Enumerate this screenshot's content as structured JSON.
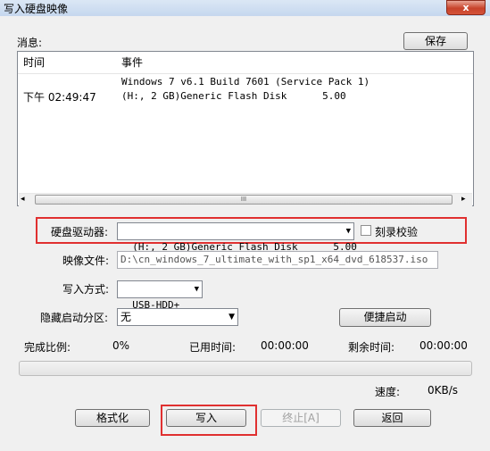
{
  "window": {
    "title": "写入硬盘映像",
    "close_label": "x"
  },
  "messages": {
    "label": "消息:",
    "save_button": "保存",
    "columns": {
      "time": "时间",
      "event": "事件"
    },
    "rows": [
      {
        "time": "",
        "event": "Windows 7 v6.1 Build 7601 (Service Pack 1)"
      },
      {
        "time": "下午 02:49:47",
        "event": "(H:, 2 GB)Generic Flash Disk      5.00"
      }
    ],
    "scroll_thumb": "III"
  },
  "drive": {
    "label": "硬盘驱动器:",
    "value": "(H:, 2 GB)Generic Flash Disk      5.00",
    "verify_label": "刻录校验",
    "verify_checked": false
  },
  "image_file": {
    "label": "映像文件:",
    "value": "D:\\cn_windows_7_ultimate_with_sp1_x64_dvd_618537.iso"
  },
  "write_mode": {
    "label": "写入方式:",
    "value": "USB-HDD+"
  },
  "hidden_partition": {
    "label": "隐藏启动分区:",
    "value": "无",
    "quick_boot_button": "便捷启动"
  },
  "status": {
    "percent_label": "完成比例:",
    "percent_value": "0%",
    "elapsed_label": "已用时间:",
    "elapsed_value": "00:00:00",
    "remaining_label": "剩余时间:",
    "remaining_value": "00:00:00",
    "progress": 0,
    "speed_label": "速度:",
    "speed_value": "0KB/s"
  },
  "buttons": {
    "format": "格式化",
    "write": "写入",
    "stop": "终止[A]",
    "back": "返回"
  },
  "colors": {
    "highlight_border": "#e03030",
    "title_gradient": "#c5d7ee",
    "close_button": "#c8432b"
  }
}
